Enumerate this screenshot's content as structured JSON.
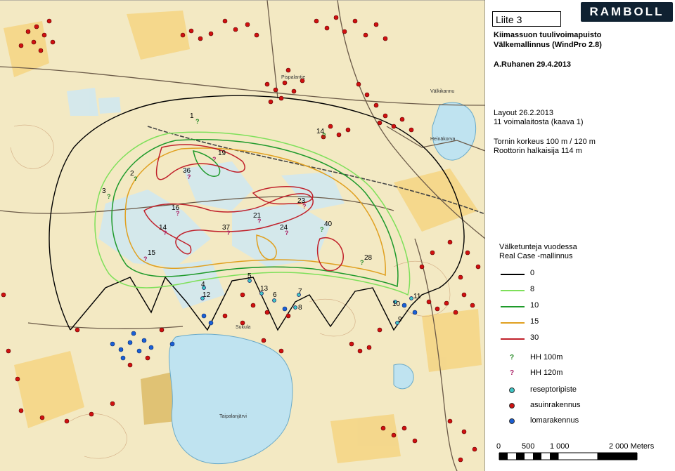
{
  "panel": {
    "liite": "Liite 3",
    "logo": "RAMBOLL",
    "title_line1": "Kiimassuon tuulivoimapuisto",
    "title_line2": "Välkemallinnus (WindPro 2.8)",
    "author_date": "A.Ruhanen 29.4.2013",
    "layout_date": "Layout 26.2.2013",
    "layout_desc": "11 voimalaitosta (kaava 1)",
    "tower_height": "Tornin korkeus 100 m / 120 m",
    "rotor": "Roottorin halkaisija 114 m",
    "legend_title1": "Välketunteja vuodessa",
    "legend_title2": "Real Case -mallinnus",
    "legend_lines": [
      {
        "label": "0",
        "color": "#000000"
      },
      {
        "label": "8",
        "color": "#7ee05a"
      },
      {
        "label": "10",
        "color": "#1e9a2a"
      },
      {
        "label": "15",
        "color": "#e0a020"
      },
      {
        "label": "30",
        "color": "#c0202a"
      }
    ],
    "legend_symbols": [
      {
        "label": "HH 100m",
        "glyph": "?",
        "color": "#228822"
      },
      {
        "label": "HH 120m",
        "glyph": "?",
        "color": "#aa2266"
      }
    ],
    "legend_dots": [
      {
        "label": "reseptoripiste",
        "color": "#3ec6c6"
      },
      {
        "label": "asuinrakennus",
        "color": "#d01010"
      },
      {
        "label": "lomarakennus",
        "color": "#1a5fd6"
      }
    ],
    "scale": {
      "labels": [
        "0",
        "500",
        "1 000",
        "2 000 Meters"
      ]
    }
  },
  "map": {
    "turbines": [
      {
        "id": "1",
        "kind": "HH 100m"
      },
      {
        "id": "2",
        "kind": "HH 100m"
      },
      {
        "id": "3",
        "kind": "HH 100m"
      },
      {
        "id": "14",
        "kind": "HH 100m"
      },
      {
        "id": "19",
        "kind": "HH 120m"
      },
      {
        "id": "36",
        "kind": "HH 120m"
      },
      {
        "id": "16",
        "kind": "HH 120m"
      },
      {
        "id": "23",
        "kind": "HH 120m"
      },
      {
        "id": "21",
        "kind": "HH 120m"
      },
      {
        "id": "37",
        "kind": "HH 120m"
      },
      {
        "id": "24",
        "kind": "HH 120m"
      },
      {
        "id": "40",
        "kind": "HH 100m"
      },
      {
        "id": "14",
        "kind": "HH 120m"
      },
      {
        "id": "15",
        "kind": "HH 120m"
      },
      {
        "id": "28",
        "kind": "HH 100m"
      }
    ],
    "receptors": [
      "4",
      "12",
      "5",
      "13",
      "6",
      "7",
      "8",
      "10",
      "11",
      "9"
    ],
    "place_names": [
      "Sukula",
      "Taipalanjärvi",
      "Heinäkorva",
      "Pispalantie",
      "Välkikannu"
    ]
  }
}
